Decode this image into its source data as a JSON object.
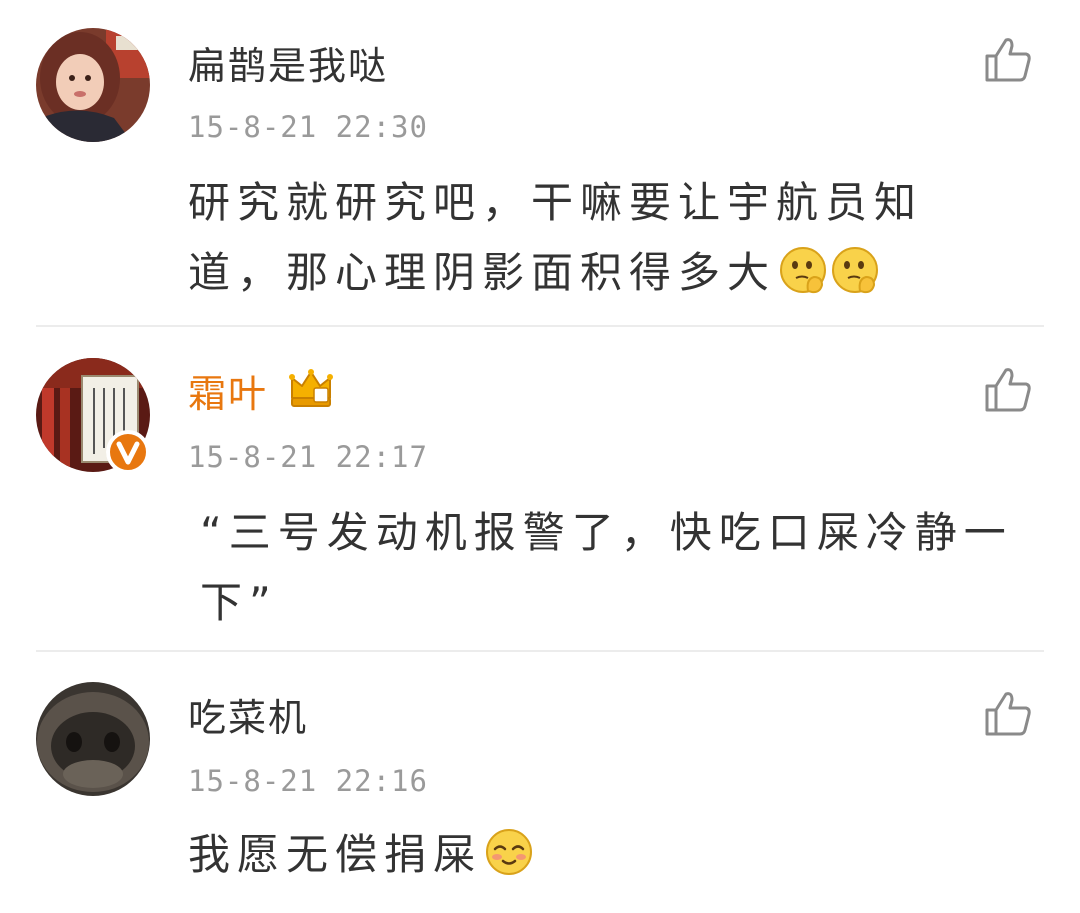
{
  "comments": [
    {
      "username": "扁鹊是我哒",
      "vip": false,
      "verified": false,
      "timestamp": "15-8-21 22:30",
      "text": "研究就研究吧，干嘛要让宇航员知道，那心理阴影面积得多大",
      "emojis": [
        "thinking-emoji",
        "thinking-emoji"
      ]
    },
    {
      "username": "霜叶",
      "vip": true,
      "verified": true,
      "timestamp": "15-8-21 22:17",
      "text": "“三号发动机报警了，快吃口屎冷静一下”",
      "emojis": []
    },
    {
      "username": "吃菜机",
      "vip": false,
      "verified": false,
      "timestamp": "15-8-21 22:16",
      "text": "我愿无偿捐屎",
      "emojis": [
        "shy-smile-emoji"
      ]
    }
  ],
  "colors": {
    "vip_name": "#e8770f",
    "text": "#333333",
    "timestamp": "#9a9a9a",
    "divider": "#ececec",
    "verified_badge": "#e8770f",
    "like_icon": "#8a8a8a"
  },
  "icons": {
    "like": "thumbs-up-icon",
    "vip": "crown-icon",
    "verified": "verified-v-icon"
  }
}
